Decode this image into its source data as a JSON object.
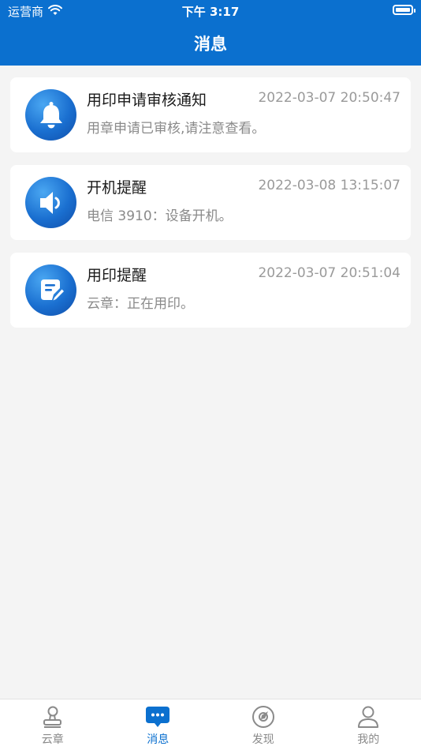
{
  "status_bar": {
    "carrier": "运营商",
    "time": "下午 3:17"
  },
  "header": {
    "title": "消息"
  },
  "messages": [
    {
      "icon": "bell-icon",
      "title": "用印申请审核通知",
      "time": "2022-03-07 20:50:47",
      "desc": "用章申请已审核,请注意查看。"
    },
    {
      "icon": "speaker-icon",
      "title": "开机提醒",
      "time": "2022-03-08 13:15:07",
      "desc": "电信 3910：设备开机。"
    },
    {
      "icon": "edit-document-icon",
      "title": "用印提醒",
      "time": "2022-03-07 20:51:04",
      "desc": "云章：正在用印。"
    }
  ],
  "tabbar": {
    "items": [
      {
        "label": "云章",
        "icon": "seal-icon",
        "active": false
      },
      {
        "label": "消息",
        "icon": "chat-bubble-icon",
        "active": true
      },
      {
        "label": "发现",
        "icon": "compass-icon",
        "active": false
      },
      {
        "label": "我的",
        "icon": "person-icon",
        "active": false
      }
    ]
  },
  "colors": {
    "primary": "#0b70cf",
    "background": "#f4f4f4",
    "inactive": "#8a8a8a"
  }
}
